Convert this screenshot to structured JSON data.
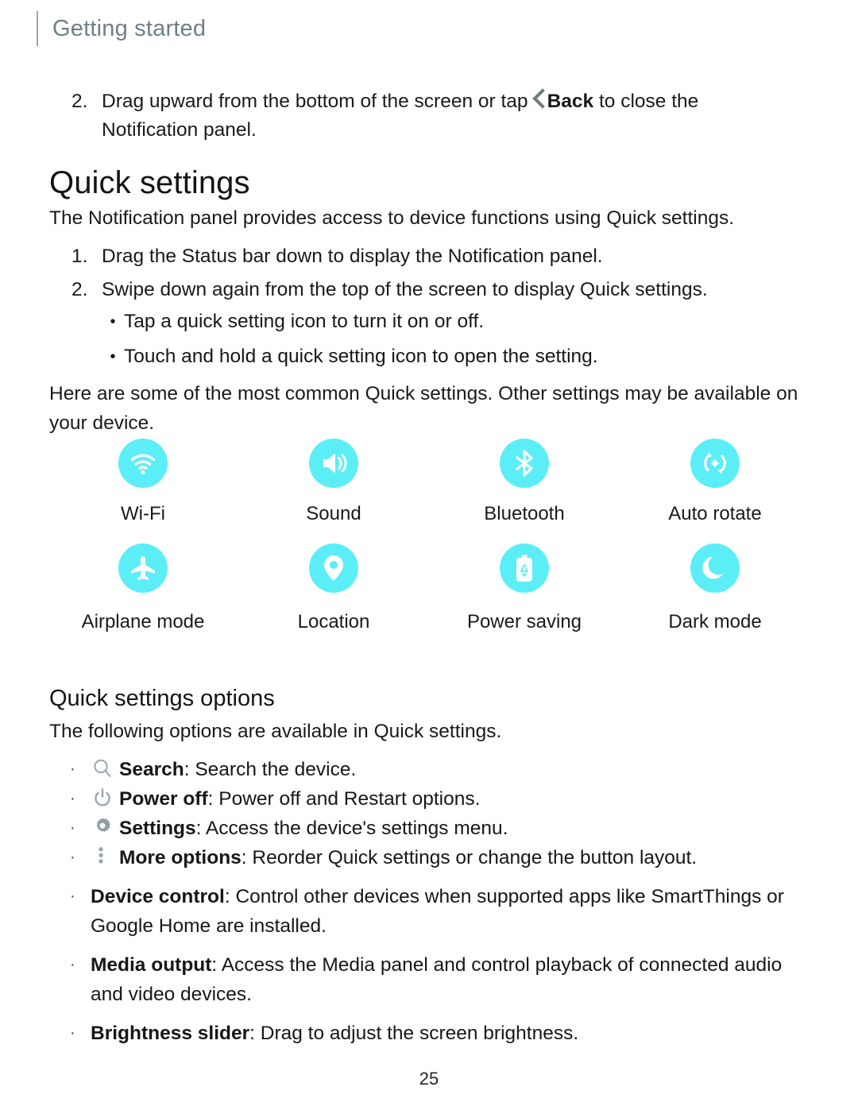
{
  "header": {
    "title": "Getting started"
  },
  "intro_step": {
    "number": "2.",
    "text_before": "Drag upward from the bottom of the screen or tap",
    "back_label": "Back",
    "text_after": "to close the",
    "line2": "Notification panel.",
    "back_icon": "chevron-left-icon"
  },
  "quick_settings": {
    "heading": "Quick settings",
    "intro": "The Notification panel provides access to device functions using Quick settings.",
    "steps": [
      {
        "number": "1.",
        "text": "Drag the Status bar down to display the Notification panel."
      },
      {
        "number": "2.",
        "text": "Swipe down again from the top of the screen to display Quick settings."
      }
    ],
    "bullets": [
      "Tap a quick setting icon to turn it on or off.",
      "Touch and hold a quick setting icon to open the setting."
    ],
    "note": "Here are some of the most common Quick settings. Other settings may be available on your device.",
    "bullet_glyph": "•",
    "icon_color": "#5CEEF6",
    "tiles": [
      {
        "label": "Wi-Fi",
        "icon": "wifi-icon"
      },
      {
        "label": "Sound",
        "icon": "sound-icon"
      },
      {
        "label": "Bluetooth",
        "icon": "bluetooth-icon"
      },
      {
        "label": "Auto rotate",
        "icon": "auto-rotate-icon"
      },
      {
        "label": "Airplane mode",
        "icon": "airplane-icon"
      },
      {
        "label": "Location",
        "icon": "location-pin-icon"
      },
      {
        "label": "Power saving",
        "icon": "power-saving-battery-icon"
      },
      {
        "label": "Dark mode",
        "icon": "moon-icon"
      }
    ]
  },
  "quick_settings_options": {
    "heading": "Quick settings options",
    "intro": "The following options are available in Quick settings.",
    "bullet_glyph": "·",
    "glyph_color": "#94a4a6",
    "items": [
      {
        "icon": "search-icon",
        "term": "Search",
        "sep": ": ",
        "desc": "Search the device."
      },
      {
        "icon": "power-off-icon",
        "term": "Power off",
        "sep": ": ",
        "desc": "Power off and Restart options."
      },
      {
        "icon": "gear-icon",
        "term": "Settings",
        "sep": ": ",
        "desc": "Access the device's settings menu."
      },
      {
        "icon": "more-options-icon",
        "term": "More options",
        "sep": ": ",
        "desc": "Reorder Quick settings or change the button layout."
      },
      {
        "icon": "none",
        "term": "Device control",
        "sep": ": ",
        "desc": "Control other devices when supported apps like SmartThings or Google Home are installed."
      },
      {
        "icon": "none",
        "term": "Media output",
        "sep": ": ",
        "desc": "Access the Media panel and control playback of connected audio and video devices."
      },
      {
        "icon": "none",
        "term": "Brightness slider",
        "sep": ": ",
        "desc": "Drag to adjust the screen brightness."
      }
    ]
  },
  "footer": {
    "page_number": "25"
  }
}
